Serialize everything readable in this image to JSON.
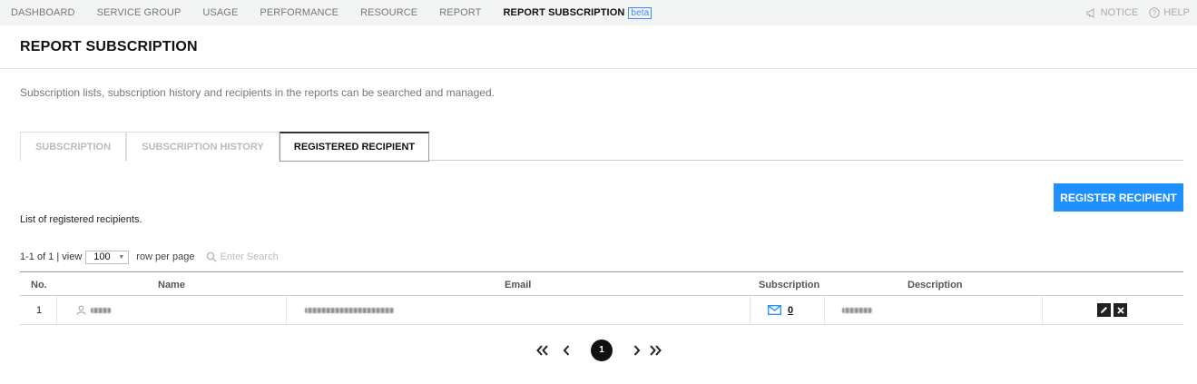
{
  "nav": {
    "items": [
      {
        "label": "DASHBOARD"
      },
      {
        "label": "SERVICE GROUP"
      },
      {
        "label": "USAGE"
      },
      {
        "label": "PERFORMANCE"
      },
      {
        "label": "RESOURCE"
      },
      {
        "label": "REPORT"
      },
      {
        "label": "REPORT SUBSCRIPTION",
        "active": true
      }
    ],
    "beta_label": "beta",
    "notice_label": "NOTICE",
    "help_label": "HELP"
  },
  "page": {
    "title": "REPORT SUBSCRIPTION",
    "description": "Subscription lists, subscription history and recipients in the reports can be searched and managed."
  },
  "tabs": [
    {
      "label": "SUBSCRIPTION"
    },
    {
      "label": "SUBSCRIPTION HISTORY"
    },
    {
      "label": "REGISTERED RECIPIENT",
      "active": true
    }
  ],
  "register_button": "REGISTER RECIPIENT",
  "list_description": "List of registered recipients.",
  "toolbar": {
    "range": "1-1 of 1 | view",
    "view_value": "100",
    "rows_per_page": "row per page",
    "search_placeholder": "Enter Search"
  },
  "table": {
    "columns": [
      "No.",
      "Name",
      "Email",
      "Subscription",
      "Description"
    ],
    "rows": [
      {
        "no": "1",
        "subscription_count": "0"
      }
    ]
  },
  "pagination": {
    "current_page": "1"
  },
  "colors": {
    "accent": "#1e90ff",
    "nav_bg": "#f2f3f3"
  }
}
